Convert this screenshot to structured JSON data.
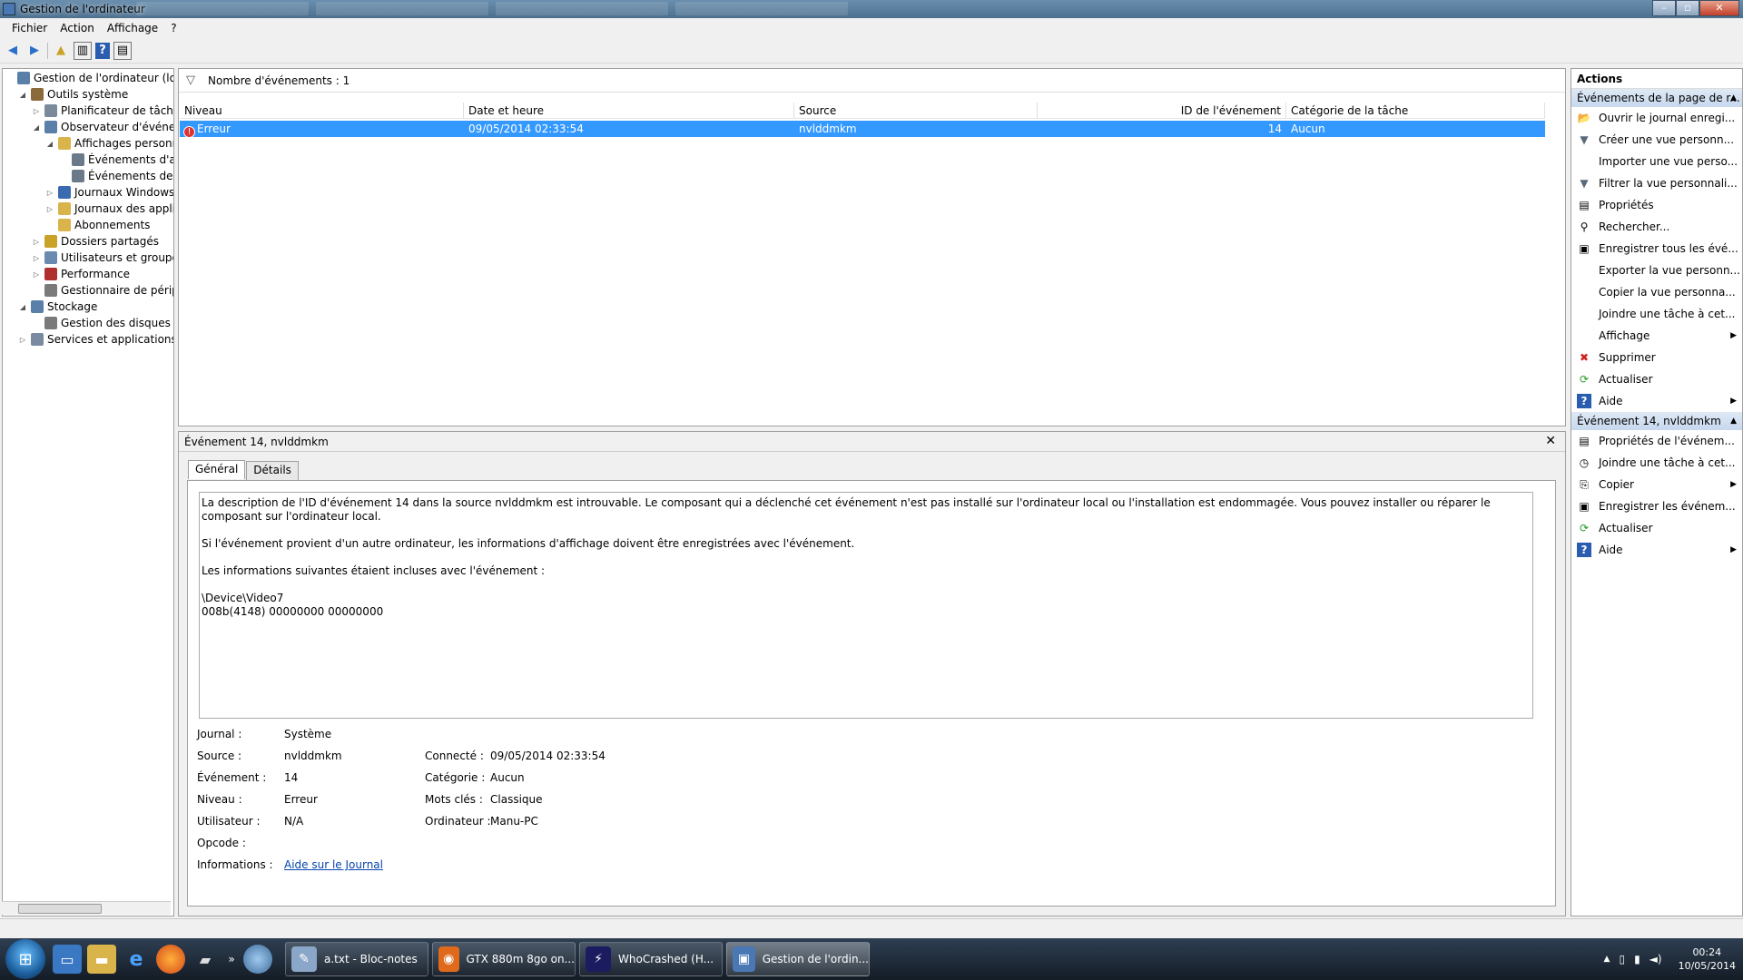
{
  "window": {
    "title": "Gestion de l'ordinateur"
  },
  "menu": [
    "Fichier",
    "Action",
    "Affichage",
    "?"
  ],
  "tree": [
    {
      "label": "Gestion de l'ordinateur (local)",
      "level": 0,
      "expander": ""
    },
    {
      "label": "Outils système",
      "level": 1,
      "expander": "◢"
    },
    {
      "label": "Planificateur de tâches",
      "level": 2,
      "expander": "▷"
    },
    {
      "label": "Observateur d'événeme",
      "level": 2,
      "expander": "◢"
    },
    {
      "label": "Affichages personna",
      "level": 3,
      "expander": "◢"
    },
    {
      "label": "Événements d'a",
      "level": 4,
      "expander": ""
    },
    {
      "label": "Événements de l",
      "level": 4,
      "expander": ""
    },
    {
      "label": "Journaux Windows",
      "level": 3,
      "expander": "▷"
    },
    {
      "label": "Journaux des applic",
      "level": 3,
      "expander": "▷"
    },
    {
      "label": "Abonnements",
      "level": 3,
      "expander": ""
    },
    {
      "label": "Dossiers partagés",
      "level": 2,
      "expander": "▷"
    },
    {
      "label": "Utilisateurs et groupes l",
      "level": 2,
      "expander": "▷"
    },
    {
      "label": "Performance",
      "level": 2,
      "expander": "▷"
    },
    {
      "label": "Gestionnaire de périphé",
      "level": 2,
      "expander": ""
    },
    {
      "label": "Stockage",
      "level": 1,
      "expander": "◢"
    },
    {
      "label": "Gestion des disques",
      "level": 2,
      "expander": ""
    },
    {
      "label": "Services et applications",
      "level": 1,
      "expander": "▷"
    }
  ],
  "list": {
    "filter_text": "Nombre d'événements : 1",
    "columns": [
      "Niveau",
      "Date et heure",
      "Source",
      "ID de l'événement",
      "Catégorie de la tâche"
    ],
    "rows": [
      {
        "level": "Erreur",
        "datetime": "09/05/2014 02:33:54",
        "source": "nvlddmkm",
        "id": "14",
        "category": "Aucun"
      }
    ]
  },
  "detail": {
    "header": "Événement 14, nvlddmkm",
    "close": "✕",
    "tabs": [
      "Général",
      "Détails"
    ],
    "description": [
      "La description de l'ID d'événement 14 dans la source nvlddmkm est introuvable. Le composant qui a déclenché cet événement n'est pas installé sur l'ordinateur local ou l'installation est endommagée. Vous pouvez installer ou réparer le composant sur l'ordinateur local.",
      "Si l'événement provient d'un autre ordinateur, les informations d'affichage doivent être enregistrées avec l'événement.",
      "Les informations suivantes étaient incluses avec l'événement :",
      "\\Device\\Video7",
      "008b(4148) 00000000 00000000"
    ],
    "props": {
      "journal_label": "Journal :",
      "journal": "Système",
      "source_label": "Source :",
      "source": "nvlddmkm",
      "connecte_label": "Connecté :",
      "connecte": "09/05/2014 02:33:54",
      "evenement_label": "Événement :",
      "evenement": "14",
      "categorie_label": "Catégorie :",
      "categorie": "Aucun",
      "niveau_label": "Niveau :",
      "niveau": "Erreur",
      "motscles_label": "Mots clés :",
      "motscles": "Classique",
      "utilisateur_label": "Utilisateur :",
      "utilisateur": "N/A",
      "ordinateur_label": "Ordinateur :",
      "ordinateur": "Manu-PC",
      "opcode_label": "Opcode :",
      "opcode": "",
      "informations_label": "Informations :",
      "informations_link": "Aide sur le Journal"
    }
  },
  "actions": {
    "title": "Actions",
    "section1": "Événements de la page de r...",
    "items1": [
      {
        "label": "Ouvrir le journal enregi...",
        "icon": "open-log-icon",
        "glyph": "📂",
        "sub": false
      },
      {
        "label": "Créer une vue personn...",
        "icon": "create-view-icon",
        "glyph": "▼",
        "sub": false
      },
      {
        "label": "Importer une vue perso...",
        "icon": "",
        "glyph": "",
        "sub": false
      },
      {
        "label": "Filtrer la vue personnali...",
        "icon": "filter-icon",
        "glyph": "▼",
        "sub": false
      },
      {
        "label": "Propriétés",
        "icon": "properties-icon",
        "glyph": "▤",
        "sub": false
      },
      {
        "label": "Rechercher...",
        "icon": "binoculars-icon",
        "glyph": "⚲",
        "sub": false
      },
      {
        "label": "Enregistrer tous les évé...",
        "icon": "save-icon",
        "glyph": "▣",
        "sub": false
      },
      {
        "label": "Exporter la vue personn...",
        "icon": "",
        "glyph": "",
        "sub": false
      },
      {
        "label": "Copier la vue personna...",
        "icon": "",
        "glyph": "",
        "sub": false
      },
      {
        "label": "Joindre une tâche à cet...",
        "icon": "",
        "glyph": "",
        "sub": false
      },
      {
        "label": "Affichage",
        "icon": "",
        "glyph": "",
        "sub": true
      },
      {
        "label": "Supprimer",
        "icon": "delete-icon",
        "glyph": "✖",
        "sub": false
      },
      {
        "label": "Actualiser",
        "icon": "refresh-icon",
        "glyph": "⟳",
        "sub": false
      },
      {
        "label": "Aide",
        "icon": "help-icon",
        "glyph": "?",
        "sub": true
      }
    ],
    "section2": "Événement 14, nvlddmkm",
    "items2": [
      {
        "label": "Propriétés de l'événem...",
        "icon": "event-properties-icon",
        "glyph": "▤",
        "sub": false
      },
      {
        "label": "Joindre une tâche à cet...",
        "icon": "attach-task-icon",
        "glyph": "◷",
        "sub": false
      },
      {
        "label": "Copier",
        "icon": "copy-icon",
        "glyph": "⎘",
        "sub": true
      },
      {
        "label": "Enregistrer les événem...",
        "icon": "save-icon",
        "glyph": "▣",
        "sub": false
      },
      {
        "label": "Actualiser",
        "icon": "refresh-icon",
        "glyph": "⟳",
        "sub": false
      },
      {
        "label": "Aide",
        "icon": "help-icon",
        "glyph": "?",
        "sub": true
      }
    ]
  },
  "taskbar": {
    "tasks": [
      {
        "label": "a.txt - Bloc-notes",
        "icon": "notepad-icon"
      },
      {
        "label": "GTX 880m 8go on...",
        "icon": "firefox-icon"
      },
      {
        "label": "WhoCrashed  (H...",
        "icon": "whocrashed-icon"
      },
      {
        "label": "Gestion de l'ordin...",
        "icon": "computer-management-icon"
      }
    ],
    "time": "00:24",
    "date": "10/05/2014"
  },
  "colors": {
    "selection": "#3399ff",
    "error": "#dd3333",
    "link": "#0645ad"
  }
}
